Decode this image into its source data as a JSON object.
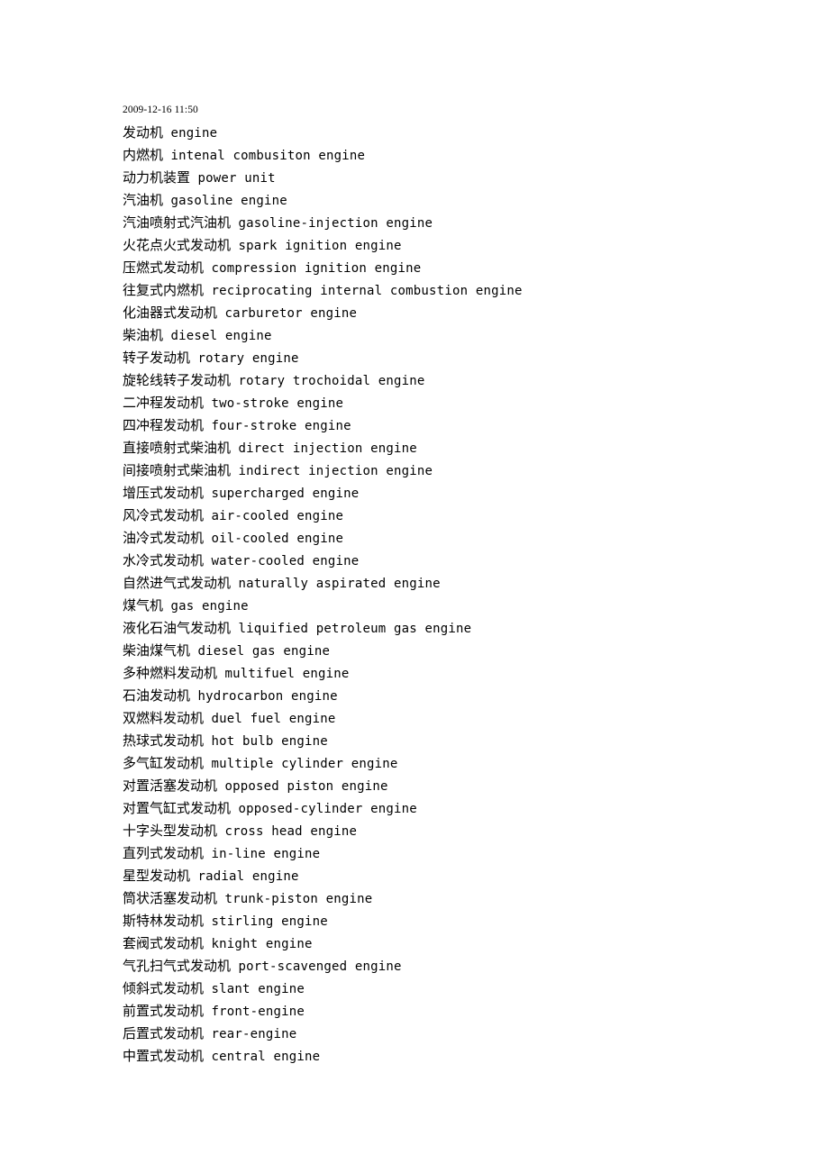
{
  "document": {
    "timestamp": "2009-12-16 11:50",
    "background_color": "#ffffff",
    "text_color": "#000000",
    "entries": [
      {
        "cn": "发动机",
        "en": "engine"
      },
      {
        "cn": "内燃机",
        "en": "intenal combusiton engine"
      },
      {
        "cn": "动力机装置",
        "en": "power unit"
      },
      {
        "cn": "汽油机",
        "en": "gasoline engine"
      },
      {
        "cn": "汽油喷射式汽油机",
        "en": "gasoline-injection engine"
      },
      {
        "cn": "火花点火式发动机",
        "en": "spark ignition engine"
      },
      {
        "cn": "压燃式发动机",
        "en": "compression ignition engine"
      },
      {
        "cn": "往复式内燃机",
        "en": "reciprocating internal combustion engine"
      },
      {
        "cn": "化油器式发动机",
        "en": "carburetor engine"
      },
      {
        "cn": "柴油机",
        "en": "diesel engine"
      },
      {
        "cn": "转子发动机",
        "en": "rotary engine"
      },
      {
        "cn": "旋轮线转子发动机",
        "en": "rotary trochoidal engine"
      },
      {
        "cn": "二冲程发动机",
        "en": "two-stroke engine"
      },
      {
        "cn": "四冲程发动机",
        "en": "four-stroke engine"
      },
      {
        "cn": "直接喷射式柴油机",
        "en": "direct injection engine"
      },
      {
        "cn": "间接喷射式柴油机",
        "en": "indirect injection engine"
      },
      {
        "cn": "增压式发动机",
        "en": "supercharged engine"
      },
      {
        "cn": "风冷式发动机",
        "en": "air-cooled engine"
      },
      {
        "cn": "油冷式发动机",
        "en": "oil-cooled engine"
      },
      {
        "cn": "水冷式发动机",
        "en": "water-cooled engine"
      },
      {
        "cn": "自然进气式发动机",
        "en": "naturally aspirated engine"
      },
      {
        "cn": "煤气机",
        "en": "gas engine"
      },
      {
        "cn": "液化石油气发动机",
        "en": "liquified petroleum gas engine"
      },
      {
        "cn": "柴油煤气机",
        "en": "diesel gas engine"
      },
      {
        "cn": "多种燃料发动机",
        "en": "multifuel engine"
      },
      {
        "cn": "石油发动机",
        "en": "hydrocarbon engine"
      },
      {
        "cn": "双燃料发动机",
        "en": "duel fuel engine"
      },
      {
        "cn": "热球式发动机",
        "en": "hot bulb engine"
      },
      {
        "cn": "多气缸发动机",
        "en": "multiple cylinder engine"
      },
      {
        "cn": "对置活塞发动机",
        "en": "opposed piston engine"
      },
      {
        "cn": "对置气缸式发动机",
        "en": "opposed-cylinder engine"
      },
      {
        "cn": "十字头型发动机",
        "en": "cross head engine"
      },
      {
        "cn": "直列式发动机",
        "en": "in-line engine"
      },
      {
        "cn": "星型发动机",
        "en": "radial engine"
      },
      {
        "cn": "筒状活塞发动机",
        "en": "trunk-piston engine"
      },
      {
        "cn": "斯特林发动机",
        "en": "stirling engine"
      },
      {
        "cn": "套阀式发动机",
        "en": "knight engine"
      },
      {
        "cn": "气孔扫气式发动机",
        "en": "port-scavenged engine"
      },
      {
        "cn": "倾斜式发动机",
        "en": "slant engine"
      },
      {
        "cn": "前置式发动机",
        "en": "front-engine"
      },
      {
        "cn": "后置式发动机",
        "en": "rear-engine"
      },
      {
        "cn": "中置式发动机",
        "en": "central engine"
      }
    ]
  }
}
